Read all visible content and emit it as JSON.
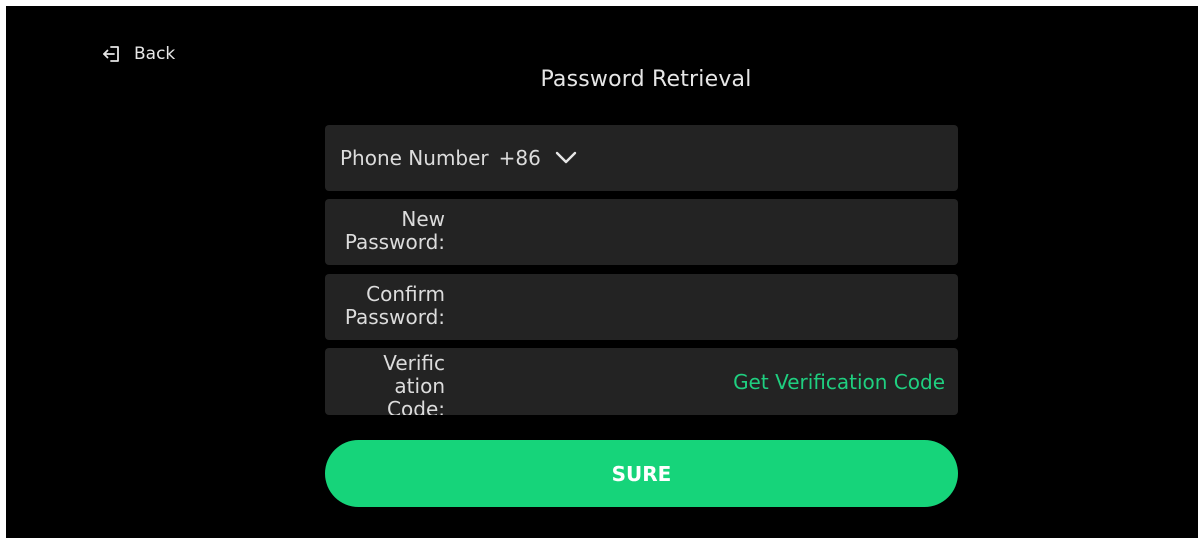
{
  "header": {
    "back_label": "Back",
    "title": "Password Retrieval"
  },
  "form": {
    "phone_label": "Phone Number",
    "country_code": "+86",
    "new_password_label": "New Password:",
    "new_password_value": "",
    "confirm_password_label": "Confirm Password:",
    "confirm_password_value": "",
    "verification_label": "Verific ation Code:",
    "verification_value": "",
    "get_code_label": "Get Verification Code"
  },
  "actions": {
    "submit_label": "SURE"
  },
  "colors": {
    "background": "#000000",
    "field_background": "#232323",
    "accent": "#16d47a",
    "link": "#1fcf80"
  },
  "icons": {
    "back": "exit-arrow-icon",
    "dropdown": "chevron-down-icon"
  }
}
